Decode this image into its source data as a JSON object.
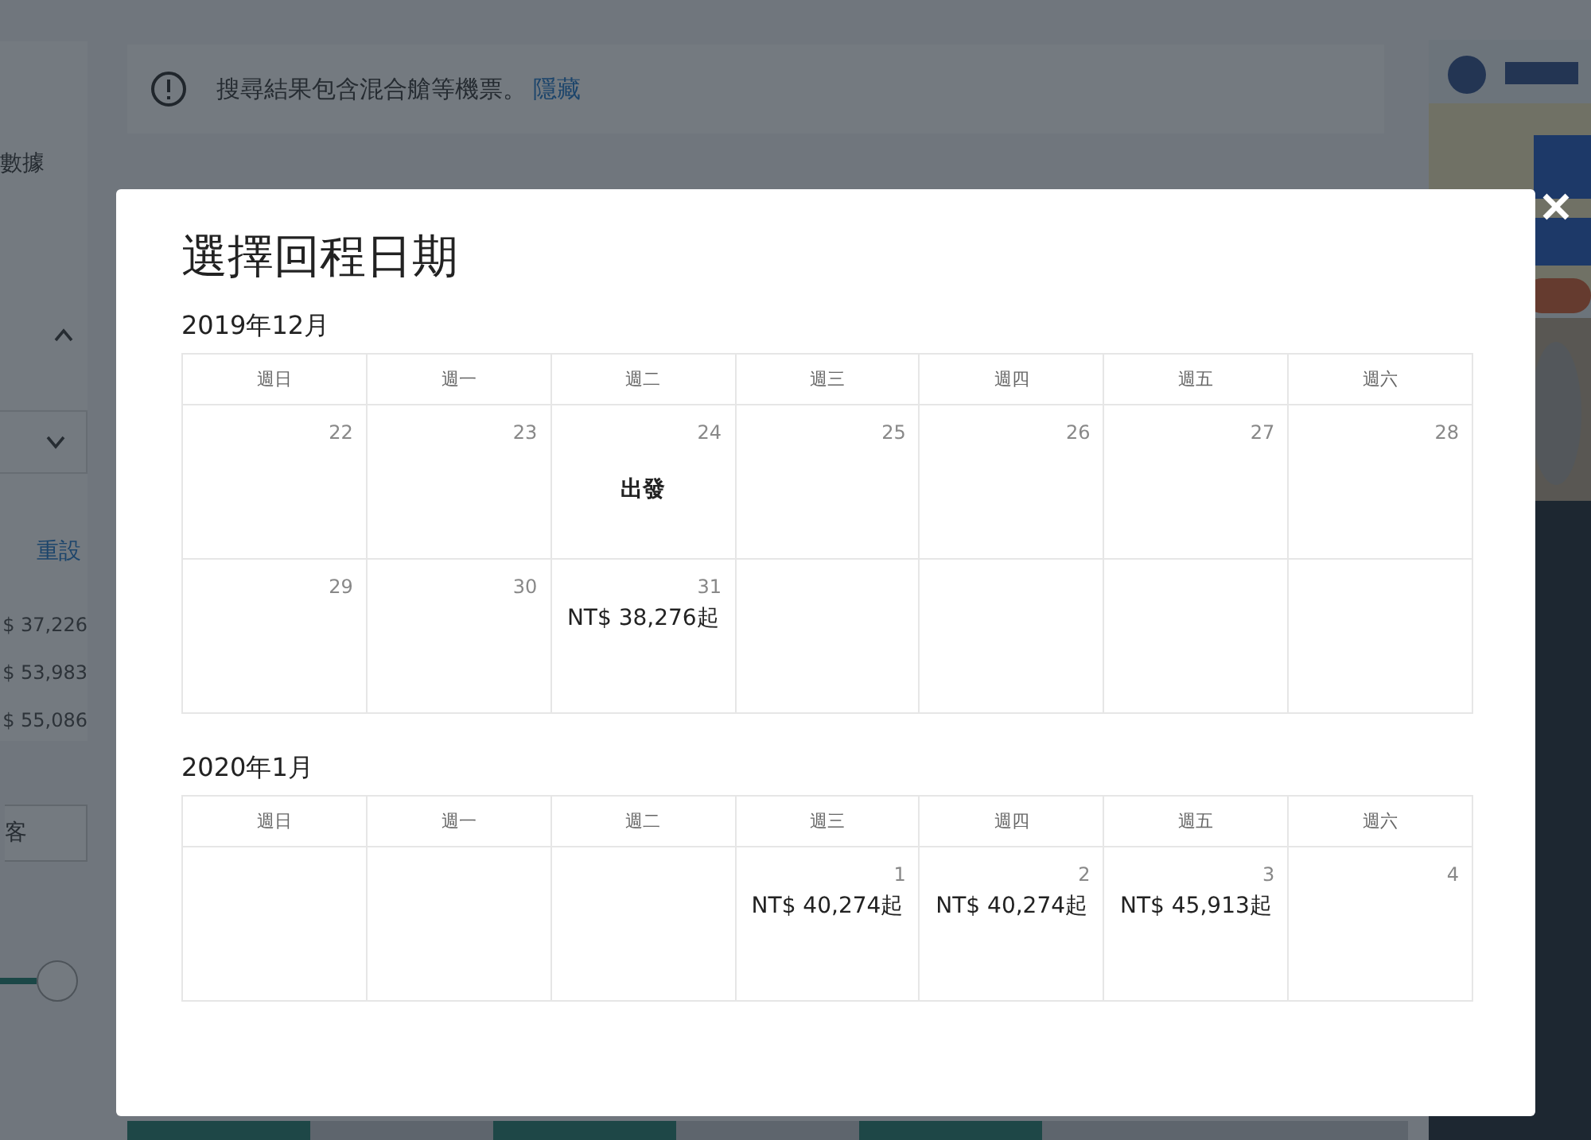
{
  "notice": {
    "text": "搜尋結果包含混合艙等機票。",
    "link": "隱藏"
  },
  "sidebar": {
    "section_label": "數據",
    "reset": "重設",
    "prices": [
      "$ 37,226",
      "$ 53,983",
      "$ 55,086"
    ],
    "field_value": "客"
  },
  "dialog": {
    "title": "選擇回程日期",
    "months": [
      {
        "label": "2019年12月",
        "weekdays": [
          "週日",
          "週一",
          "週二",
          "週三",
          "週四",
          "週五",
          "週六"
        ],
        "weeks": [
          [
            {
              "day": "22",
              "kind": "empty"
            },
            {
              "day": "23",
              "kind": "empty"
            },
            {
              "day": "24",
              "kind": "departure",
              "note": "出發"
            },
            {
              "day": "25",
              "kind": "empty"
            },
            {
              "day": "26",
              "kind": "empty"
            },
            {
              "day": "27",
              "kind": "empty"
            },
            {
              "day": "28",
              "kind": "empty"
            }
          ],
          [
            {
              "day": "29",
              "kind": "empty"
            },
            {
              "day": "30",
              "kind": "empty"
            },
            {
              "day": "31",
              "kind": "price",
              "note": "NT$ 38,276起"
            },
            {
              "kind": "blank"
            },
            {
              "kind": "blank"
            },
            {
              "kind": "blank"
            },
            {
              "kind": "blank"
            }
          ]
        ]
      },
      {
        "label": "2020年1月",
        "weekdays": [
          "週日",
          "週一",
          "週二",
          "週三",
          "週四",
          "週五",
          "週六"
        ],
        "weeks": [
          [
            {
              "kind": "blank"
            },
            {
              "kind": "blank"
            },
            {
              "kind": "blank"
            },
            {
              "day": "1",
              "kind": "price",
              "note": "NT$ 40,274起"
            },
            {
              "day": "2",
              "kind": "price",
              "note": "NT$ 40,274起"
            },
            {
              "day": "3",
              "kind": "price",
              "note": "NT$ 45,913起"
            },
            {
              "day": "4",
              "kind": "empty"
            }
          ]
        ]
      }
    ]
  }
}
